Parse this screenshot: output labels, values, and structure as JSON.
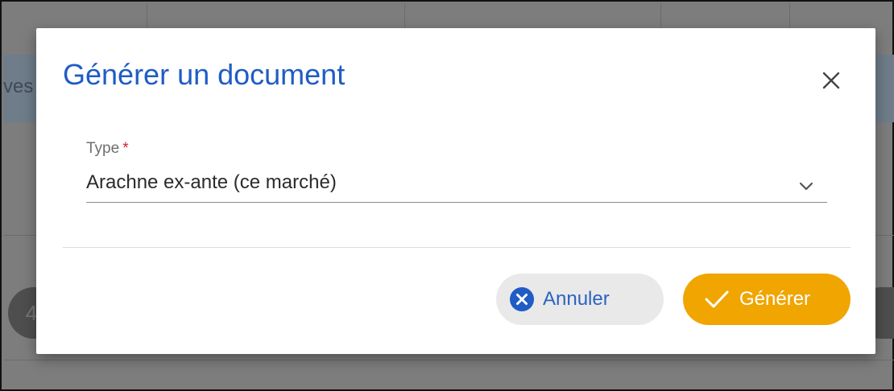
{
  "background": {
    "partial_text": "ves",
    "partial_number": "4"
  },
  "dialog": {
    "title": "Générer un document",
    "close_icon": "close-icon",
    "field": {
      "label": "Type",
      "required_mark": "*",
      "value": "Arachne ex-ante (ce marché)",
      "icon": "chevron-down-icon"
    },
    "buttons": {
      "cancel": {
        "label": "Annuler",
        "icon": "cancel-circle-icon"
      },
      "generate": {
        "label": "Générer",
        "icon": "check-icon"
      }
    }
  },
  "colors": {
    "title": "#1f5cc4",
    "primary_button": "#f0a500",
    "secondary_button": "#e9e9e9",
    "required": "#d0202e"
  }
}
